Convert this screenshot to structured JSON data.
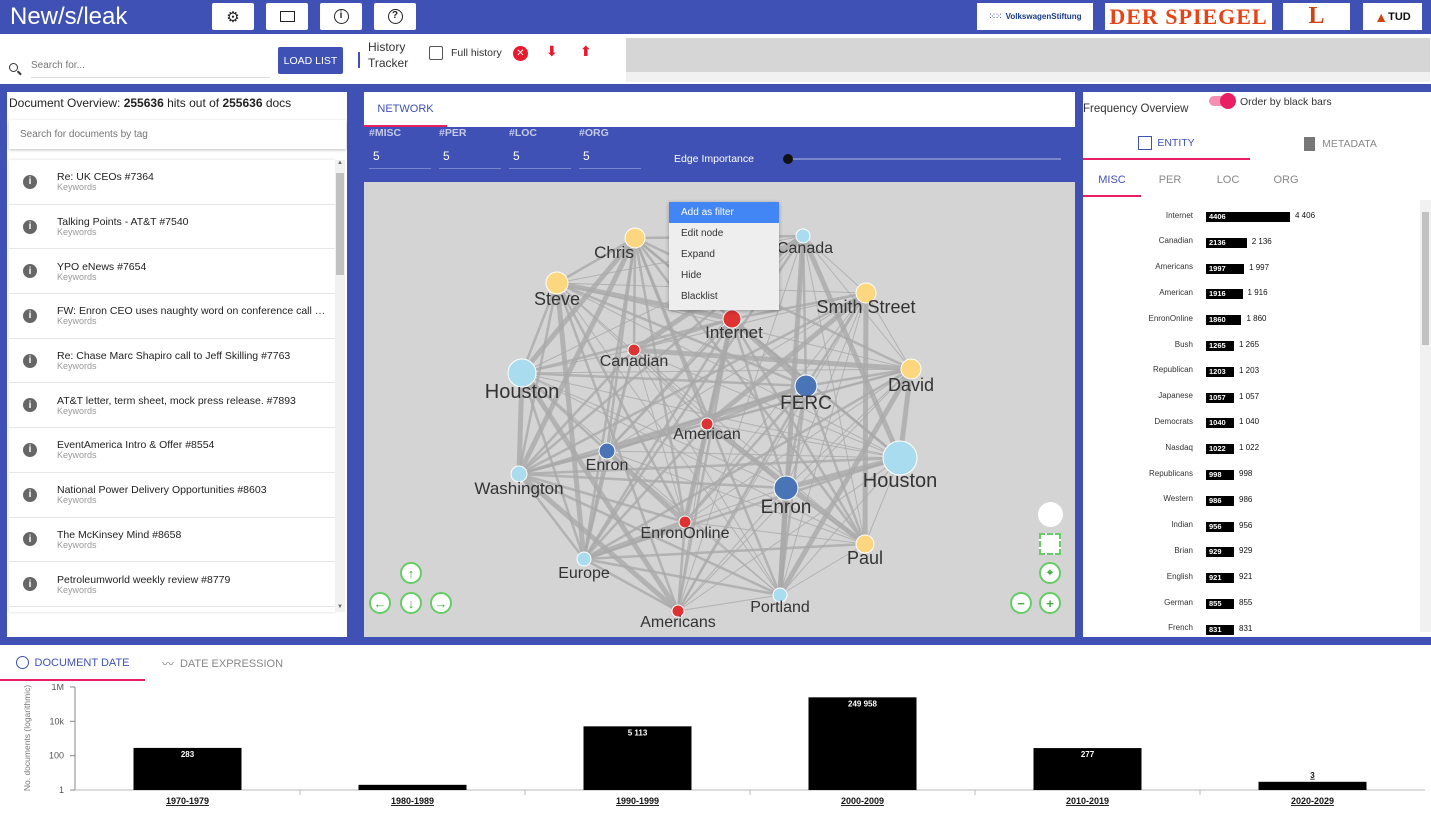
{
  "app": {
    "title": "New/s/leak"
  },
  "toolbar": {
    "icons": [
      "settings-icon",
      "fullscreen-icon",
      "info-icon",
      "help-icon"
    ]
  },
  "sponsors": {
    "vw": "VolkswagenStiftung",
    "spiegel": "DER SPIEGEL",
    "l": "L",
    "tud": "TUD"
  },
  "search": {
    "placeholder": "Search for...",
    "load_label": "LOAD LIST"
  },
  "history": {
    "label1": "History",
    "label2": "Tracker",
    "full_history_label": "Full history"
  },
  "docs": {
    "overview_prefix": "Document Overview: ",
    "hits": "255636",
    "middle": " hits out of ",
    "total": "255636",
    "suffix": " docs",
    "tag_placeholder": "Search for documents by tag",
    "items": [
      {
        "title": "Re: UK CEOs #7364",
        "sub": "Keywords"
      },
      {
        "title": "Talking Points - AT&T #7540",
        "sub": "Keywords"
      },
      {
        "title": "YPO eNews #7654",
        "sub": "Keywords"
      },
      {
        "title": "FW: Enron CEO uses naughty word on conference call #7...",
        "sub": "Keywords"
      },
      {
        "title": "Re: Chase Marc Shapiro call to Jeff Skilling #7763",
        "sub": "Keywords"
      },
      {
        "title": "AT&T letter, term sheet, mock press release. #7893",
        "sub": "Keywords"
      },
      {
        "title": "EventAmerica Intro & Offer #8554",
        "sub": "Keywords"
      },
      {
        "title": "National Power Delivery Opportunities #8603",
        "sub": "Keywords"
      },
      {
        "title": "The McKinsey Mind #8658",
        "sub": "Keywords"
      },
      {
        "title": "Petroleumworld weekly review #8779",
        "sub": "Keywords"
      }
    ]
  },
  "network": {
    "tab": "NETWORK",
    "edge_label": "Edge Importance",
    "counts": [
      {
        "label": "#MISC",
        "value": "5"
      },
      {
        "label": "#PER",
        "value": "5"
      },
      {
        "label": "#LOC",
        "value": "5"
      },
      {
        "label": "#ORG",
        "value": "5"
      }
    ],
    "menu": [
      "Add as filter",
      "Edit node",
      "Expand",
      "Hide",
      "Blacklist"
    ],
    "nodes": [
      {
        "label": "Chris",
        "color": "#fdd680"
      },
      {
        "label": "Canada",
        "color": "#a8dcee"
      },
      {
        "label": "Steve",
        "color": "#fdd680"
      },
      {
        "label": "Smith Street",
        "color": "#fdd680"
      },
      {
        "label": "Internet",
        "color": "#dd3333"
      },
      {
        "label": "Canadian",
        "color": "#dd3333"
      },
      {
        "label": "Houston",
        "color": "#a8dcee"
      },
      {
        "label": "David",
        "color": "#fdd680"
      },
      {
        "label": "FERC",
        "color": "#4a74b8"
      },
      {
        "label": "American",
        "color": "#dd3333"
      },
      {
        "label": "Enron",
        "color": "#4a74b8"
      },
      {
        "label": "Houston",
        "color": "#a8dcee"
      },
      {
        "label": "Washington",
        "color": "#a8dcee"
      },
      {
        "label": "Enron",
        "color": "#4a74b8"
      },
      {
        "label": "EnronOnline",
        "color": "#dd3333"
      },
      {
        "label": "Paul",
        "color": "#fdd680"
      },
      {
        "label": "Europe",
        "color": "#a8dcee"
      },
      {
        "label": "Portland",
        "color": "#a8dcee"
      },
      {
        "label": "Americans",
        "color": "#dd3333"
      }
    ]
  },
  "frequency": {
    "title": "Frequency Overview",
    "toggle_label": "Order by black bars",
    "tab_entity": "ENTITY",
    "tab_metadata": "METADATA",
    "subtabs": [
      "MISC",
      "PER",
      "LOC",
      "ORG"
    ],
    "rows": [
      {
        "label": "Internet",
        "value": 4406,
        "bar": "4406",
        "text": "4 406"
      },
      {
        "label": "Canadian",
        "value": 2136,
        "bar": "2136",
        "text": "2 136"
      },
      {
        "label": "Americans",
        "value": 1997,
        "bar": "1997",
        "text": "1 997"
      },
      {
        "label": "American",
        "value": 1916,
        "bar": "1916",
        "text": "1 916"
      },
      {
        "label": "EnronOnline",
        "value": 1860,
        "bar": "1860",
        "text": "1 860"
      },
      {
        "label": "Bush",
        "value": 1265,
        "bar": "1265",
        "text": "1 265"
      },
      {
        "label": "Republican",
        "value": 1203,
        "bar": "1203",
        "text": "1 203"
      },
      {
        "label": "Japanese",
        "value": 1057,
        "bar": "1057",
        "text": "1 057"
      },
      {
        "label": "Democrats",
        "value": 1040,
        "bar": "1040",
        "text": "1 040"
      },
      {
        "label": "Nasdaq",
        "value": 1022,
        "bar": "1022",
        "text": "1 022"
      },
      {
        "label": "Republicans",
        "value": 998,
        "bar": "998",
        "text": "998"
      },
      {
        "label": "Western",
        "value": 986,
        "bar": "986",
        "text": "986"
      },
      {
        "label": "Indian",
        "value": 956,
        "bar": "956",
        "text": "956"
      },
      {
        "label": "Brian",
        "value": 929,
        "bar": "929",
        "text": "929"
      },
      {
        "label": "English",
        "value": 921,
        "bar": "921",
        "text": "921"
      },
      {
        "label": "German",
        "value": 855,
        "bar": "855",
        "text": "855"
      },
      {
        "label": "French",
        "value": 831,
        "bar": "831",
        "text": "831"
      }
    ]
  },
  "timeline": {
    "tab_doc": "DOCUMENT DATE",
    "tab_expr": "DATE EXPRESSION"
  },
  "chart_data": {
    "type": "bar",
    "ylabel": "No. documents (logarithmic)",
    "yscale": "log",
    "yticks": [
      "1M",
      "10k",
      "100",
      "1"
    ],
    "categories": [
      "1970-1979",
      "1980-1989",
      "1990-1999",
      "2000-2009",
      "2010-2019",
      "2020-2029"
    ],
    "values": [
      283,
      2,
      5113,
      249958,
      277,
      3
    ],
    "labels": [
      "283",
      "",
      "5 113",
      "249 958",
      "277",
      "3"
    ]
  }
}
